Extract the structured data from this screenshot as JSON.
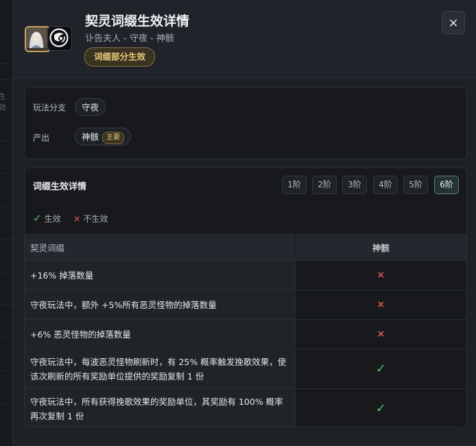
{
  "header": {
    "title": "契灵词缀生效详情",
    "subtitle": "讣告夫人 - 守夜 - 神骸",
    "badge": "词缀部分生效",
    "close_label": "×"
  },
  "background": {
    "partial_text": "生效"
  },
  "info": {
    "branch_label": "玩法分支",
    "branch_value": "守夜",
    "output_label": "产出",
    "output_value": "神骸",
    "output_tag": "主要"
  },
  "details": {
    "title": "词缀生效详情",
    "tiers": [
      "1阶",
      "2阶",
      "3阶",
      "4阶",
      "5阶",
      "6阶"
    ],
    "active_tier": "6阶",
    "legend_effective": "生效",
    "legend_not_effective": "不生效",
    "legend_effective_icon": "✓",
    "legend_not_effective_icon": "×",
    "columns": [
      "契灵词缀",
      "神骸"
    ],
    "rows": [
      {
        "name": "+16% 掉落数量",
        "status": "×",
        "effective": false
      },
      {
        "name": "守夜玩法中，额外 +5%所有恶灵怪物的掉落数量",
        "status": "×",
        "effective": false
      },
      {
        "name": "+6% 恶灵怪物的掉落数量",
        "status": "×",
        "effective": false
      },
      {
        "name": "守夜玩法中，每波恶灵怪物刷新时，有 25% 概率触发挽歌效果，使该次刷新的所有奖励单位提供的奖励复制 1 份",
        "status": "✓",
        "effective": true
      },
      {
        "name": "守夜玩法中，所有获得挽歌效果的奖励单位，其奖励有 100% 概率再次复制 1 份",
        "status": "✓",
        "effective": true
      }
    ]
  },
  "colors": {
    "accent_gold": "#e9c97a",
    "ok_green": "#56c06a",
    "no_red": "#e05a5a",
    "active_tier": "#5a7f76"
  }
}
